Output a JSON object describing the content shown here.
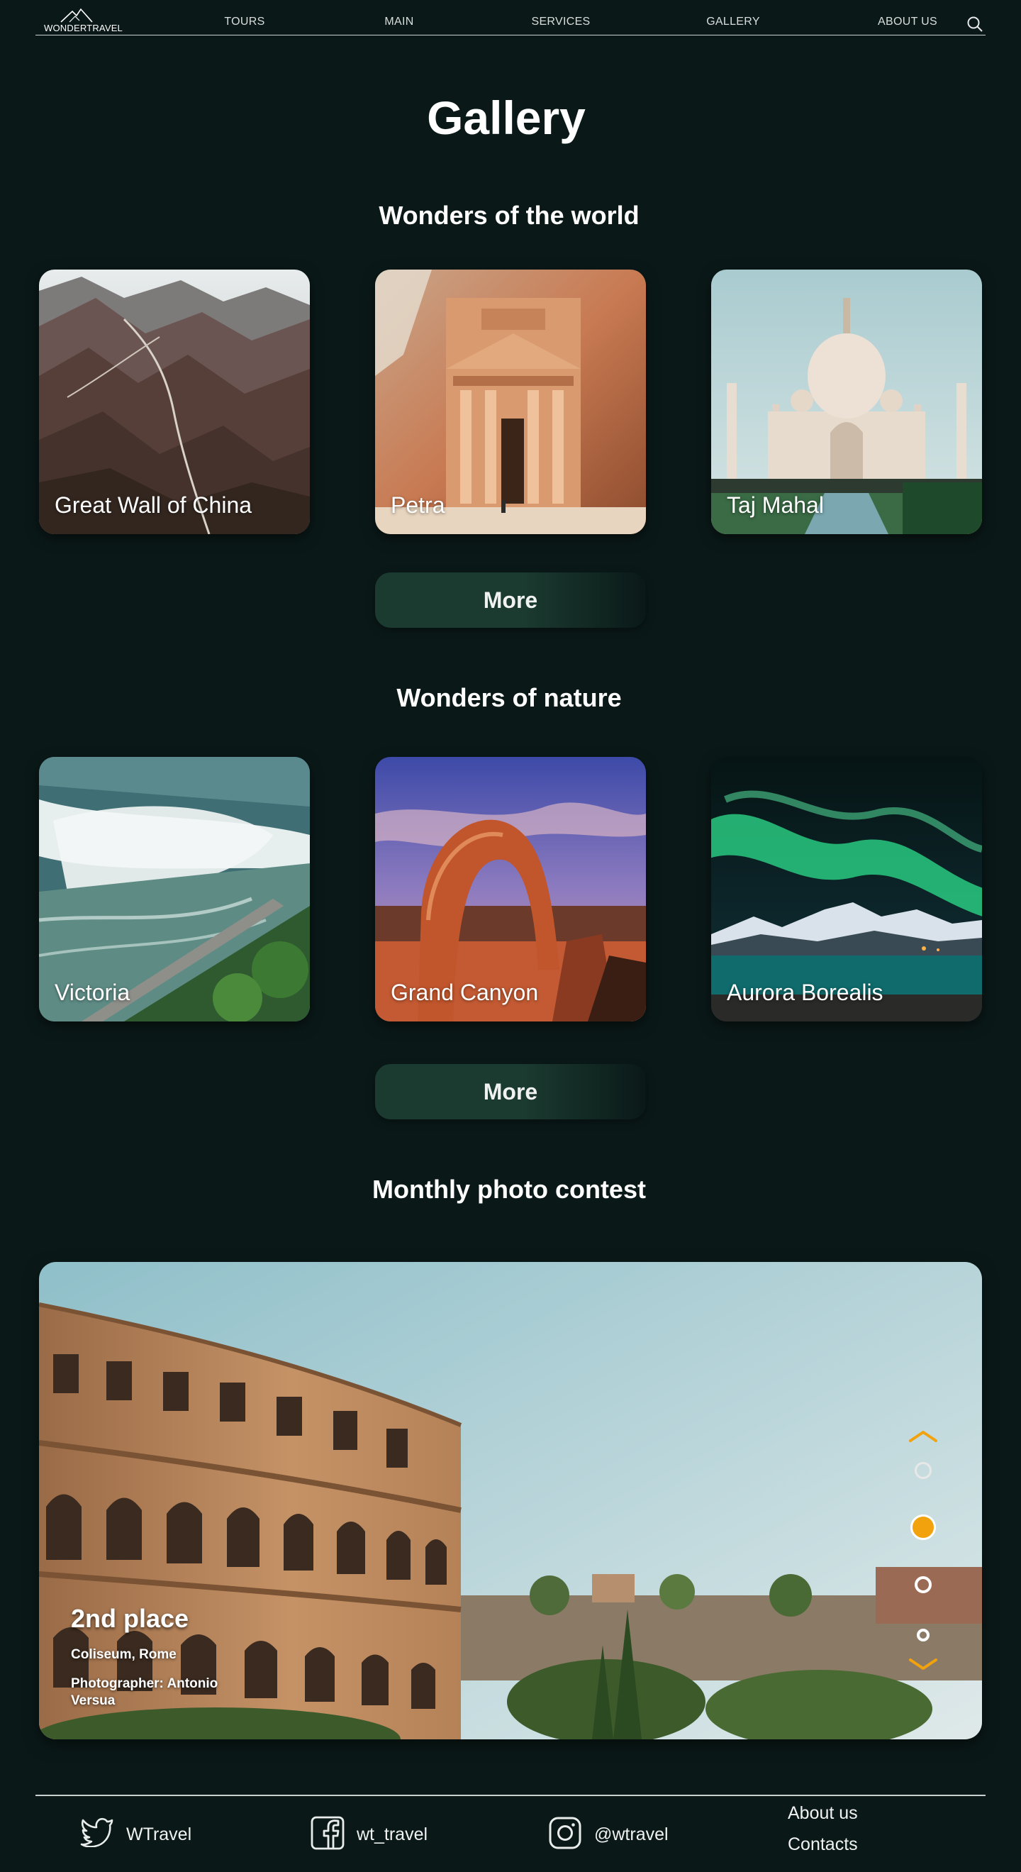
{
  "header": {
    "logo_text": "WONDERTRAVEL",
    "nav": [
      "TOURS",
      "MAIN",
      "SERVICES",
      "GALLERY",
      "ABOUT US"
    ]
  },
  "page_title": "Gallery",
  "sections": {
    "world": {
      "title": "Wonders of the world",
      "cards": [
        "Great Wall of China",
        "Petra",
        "Taj Mahal"
      ],
      "more_label": "More"
    },
    "nature": {
      "title": "Wonders of nature",
      "cards": [
        "Victoria",
        "Grand Canyon",
        "Aurora Borealis"
      ],
      "more_label": "More"
    },
    "contest": {
      "title": "Monthly photo contest",
      "place": "2nd place",
      "location": "Coliseum, Rome",
      "photographer": "Photographer: Antonio Versua",
      "slides": 4,
      "active_slide": 2
    }
  },
  "footer": {
    "social": [
      "WTravel",
      "wt_travel",
      "@wtravel"
    ],
    "social_icons": [
      "twitter-icon",
      "facebook-icon",
      "instagram-icon"
    ],
    "links": [
      "About us",
      "Contacts"
    ]
  },
  "colors": {
    "background": "#0a1918",
    "button": "#1b3a30",
    "accent": "#f2a20c"
  }
}
